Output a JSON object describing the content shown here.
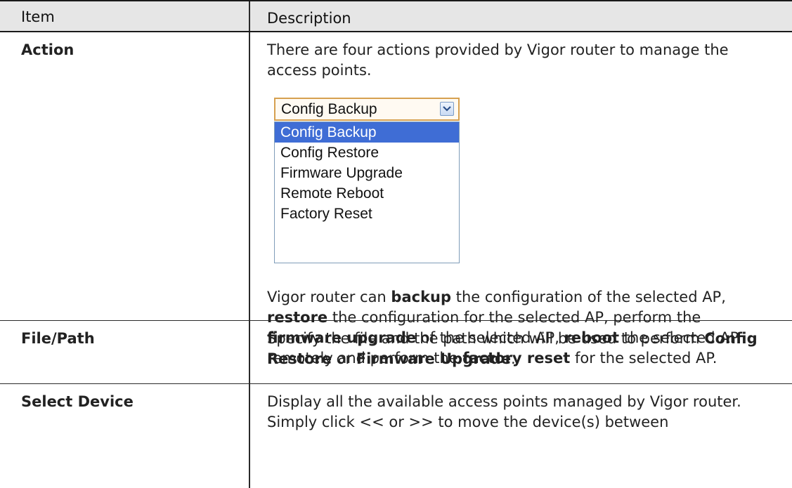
{
  "table": {
    "header": {
      "item": "Item",
      "description": "Description"
    },
    "rows": {
      "action": {
        "item": "Action",
        "intro": "There are four actions provided by Vigor router to manage the access points.",
        "select": {
          "value": "Config Backup",
          "options": [
            "Config Backup",
            "Config Restore",
            "Firmware Upgrade",
            "Remote Reboot",
            "Factory Reset"
          ],
          "selected_index": 0
        },
        "detail": {
          "t1": "Vigor router can ",
          "b1": "backup",
          "t2": " the configuration of the selected AP, ",
          "b2": "restore",
          "t3": " the configuration for the selected AP, perform the ",
          "b3": "firmware upgrade",
          "t4": " of the selected AP, ",
          "b4": "reboot",
          "t5": " the selected AP remotely and perform the ",
          "b5": "factory reset",
          "t6": " for the selected AP."
        }
      },
      "file_path": {
        "item": "File/Path",
        "t1": "Specify the file and the path which will be used to perform ",
        "b1": "Config Restore",
        "t2": " or ",
        "b2": "Firmware Upgrade",
        "t3": "."
      },
      "select_device": {
        "item": "Select Device",
        "text": "Display all the available access points managed by Vigor router. Simply click << or >> to move the device(s) between"
      }
    }
  },
  "colors": {
    "header_bg": "#e6e6e6",
    "select_border": "#d6a050",
    "selected_option_bg": "#3f6dd5",
    "rule": "#2a2a2a"
  }
}
